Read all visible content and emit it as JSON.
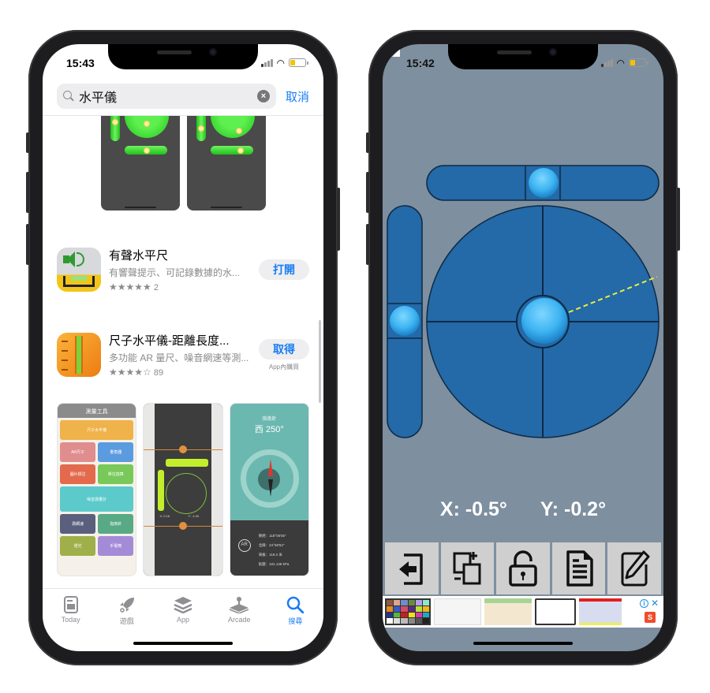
{
  "left_phone": {
    "status": {
      "time": "15:43"
    },
    "search": {
      "query": "水平儀",
      "clear_label": "×",
      "cancel_label": "取消"
    },
    "results": [
      {
        "name": "有聲水平尺",
        "subtitle": "有響聲提示、可記錄數據的水...",
        "stars": "★★★★★",
        "rating_count": "2",
        "rating_value": 5,
        "action_label": "打開"
      },
      {
        "name": "尺子水平儀-距離長度...",
        "subtitle": "多功能 AR 量尺、噪音網速等測...",
        "stars": "★★★★☆",
        "rating_count": "89",
        "rating_value": 4.5,
        "action_label": "取得",
        "iap_label": "App內購買"
      }
    ],
    "gallery": {
      "tools_title": "測量工具",
      "tools": [
        "尺子水平儀",
        "AR尺子",
        "量角器",
        "圖片標注",
        "單位換算",
        "噪音測量計",
        "測網速",
        "指南針",
        "燈光",
        "手電筒"
      ],
      "level_x": "X: 0.18",
      "level_y": "Y: -1.00",
      "compass_title": "指南針",
      "compass_heading": "西 250°",
      "compass_ar": "AR",
      "compass_info": [
        "東經：118°05'55\"",
        "北緯：24°58'52\"",
        "海拔：119.2 米",
        "氣壓：101.148 kPa"
      ]
    },
    "tabbar": [
      {
        "label": "Today",
        "icon": "today-icon",
        "active": false
      },
      {
        "label": "遊戲",
        "icon": "rocket-icon",
        "active": false
      },
      {
        "label": "App",
        "icon": "layers-icon",
        "active": false
      },
      {
        "label": "Arcade",
        "icon": "joystick-icon",
        "active": false
      },
      {
        "label": "搜尋",
        "icon": "search-icon",
        "active": true
      }
    ]
  },
  "right_phone": {
    "status": {
      "time": "15:42"
    },
    "readout": {
      "x": "X: -0.5°",
      "y": "Y: -0.2°"
    },
    "tilt": {
      "x_deg": -0.5,
      "y_deg": -0.2
    },
    "toolbar": [
      {
        "name": "exit-button",
        "icon": "exit-icon"
      },
      {
        "name": "copy-add-button",
        "icon": "copy-add-icon"
      },
      {
        "name": "lock-button",
        "icon": "unlock-icon"
      },
      {
        "name": "document-button",
        "icon": "document-icon"
      },
      {
        "name": "edit-button",
        "icon": "pencil-icon"
      }
    ],
    "ad": {
      "info_label": "i",
      "close_label": "✕",
      "brand_label": "S"
    }
  },
  "colors": {
    "ios_blue": "#1a7cf4",
    "level_bg": "#7e8f9f",
    "level_blue": "#2469a8",
    "bubble": "#3db4f2",
    "guide_line": "#e9ef3a"
  }
}
